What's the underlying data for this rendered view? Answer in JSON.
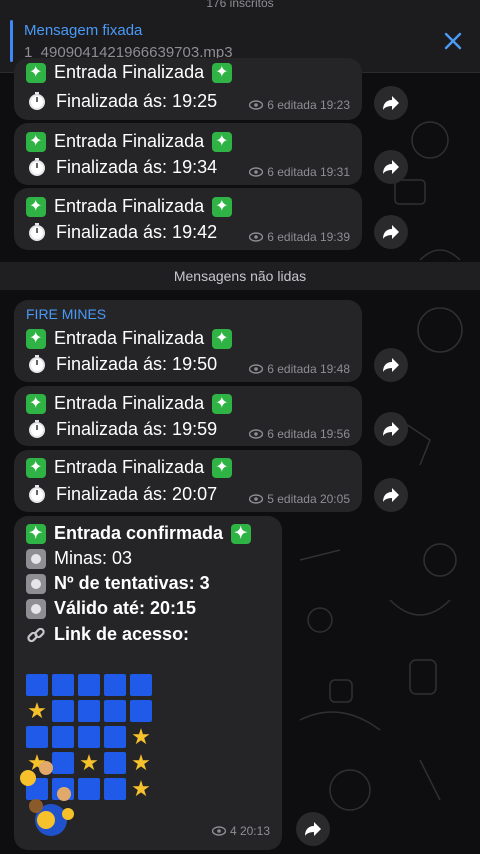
{
  "header": {
    "top_text": "176 inscritos"
  },
  "pinned": {
    "title": "Mensagem fixada",
    "subtitle": "1_4909041421966639703.mp3"
  },
  "messages_before": [
    {
      "line1": "Entrada Finalizada",
      "line2": "Finalizada ás: 19:25",
      "meta": "6 editada 19:23"
    },
    {
      "line1": "Entrada Finalizada",
      "line2": "Finalizada ás: 19:34",
      "meta": "6 editada 19:31"
    },
    {
      "line1": "Entrada Finalizada",
      "line2": "Finalizada ás: 19:42",
      "meta": "6 editada 19:39"
    }
  ],
  "divider": "Mensagens não lidas",
  "messages_after": [
    {
      "sender": "FIRE MINES",
      "line1": "Entrada Finalizada",
      "line2": "Finalizada ás: 19:50",
      "meta": "6 editada 19:48"
    },
    {
      "line1": "Entrada Finalizada",
      "line2": "Finalizada ás: 19:59",
      "meta": "6 editada 19:56"
    },
    {
      "line1": "Entrada Finalizada",
      "line2": "Finalizada ás: 20:07",
      "meta": "5 editada 20:05"
    }
  ],
  "confirmed": {
    "title": "Entrada confirmada",
    "minas": "Minas: 03",
    "tentativas": "Nº de tentativas: 3",
    "valido": "Válido até: 20:15",
    "link": "Link de acesso:",
    "meta": "4 20:13"
  },
  "grid": {
    "rows": [
      [
        "b",
        "b",
        "b",
        "b",
        "b"
      ],
      [
        "s",
        "b",
        "b",
        "b",
        "b"
      ],
      [
        "b",
        "b",
        "b",
        "b",
        "s"
      ],
      [
        "s",
        "b",
        "s",
        "b",
        "s"
      ],
      [
        "b",
        "b",
        "b",
        "b",
        "s"
      ]
    ]
  },
  "colors": {
    "accent": "#4a9af7",
    "bubble": "#252528",
    "sparkle": "#2fb344",
    "tile": "#1f5be8",
    "star": "#f6c12b"
  }
}
